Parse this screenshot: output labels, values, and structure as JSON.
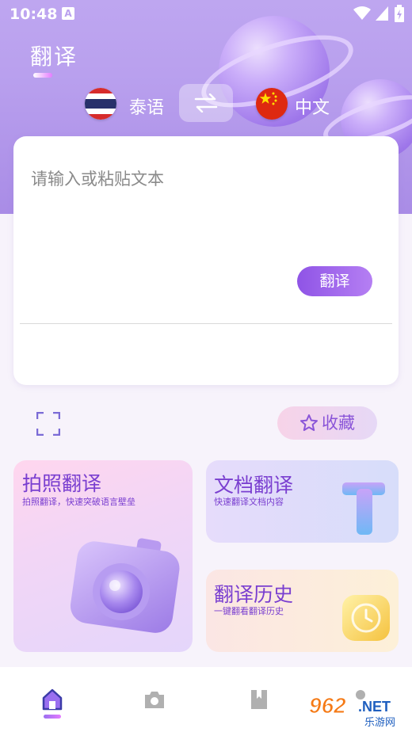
{
  "status_bar": {
    "time": "10:48",
    "notification_icon": "A"
  },
  "header": {
    "title": "翻译"
  },
  "language_bar": {
    "source_language": "泰语",
    "target_language": "中文"
  },
  "input_card": {
    "placeholder": "请输入或粘贴文本",
    "translate_button": "翻译"
  },
  "actions": {
    "favorite_button": "收藏"
  },
  "features": [
    {
      "title": "拍照翻译",
      "subtitle": "拍照翻译，快速突破语言壁垒",
      "icon": "camera-3d-icon"
    },
    {
      "title": "文档翻译",
      "subtitle": "快速翻译文档内容",
      "icon": "letter-t-3d-icon"
    },
    {
      "title": "翻译历史",
      "subtitle": "一键翻看翻译历史",
      "icon": "clock-3d-icon"
    }
  ],
  "bottom_nav": {
    "items": [
      "home-icon",
      "camera-icon",
      "bookmark-icon",
      "profile-icon"
    ]
  },
  "watermark": "962.NET 乐游网",
  "colors": {
    "accent": "#8f54e6",
    "header_bg": "#b9a0ee",
    "feature_text": "#7a3fd0"
  }
}
